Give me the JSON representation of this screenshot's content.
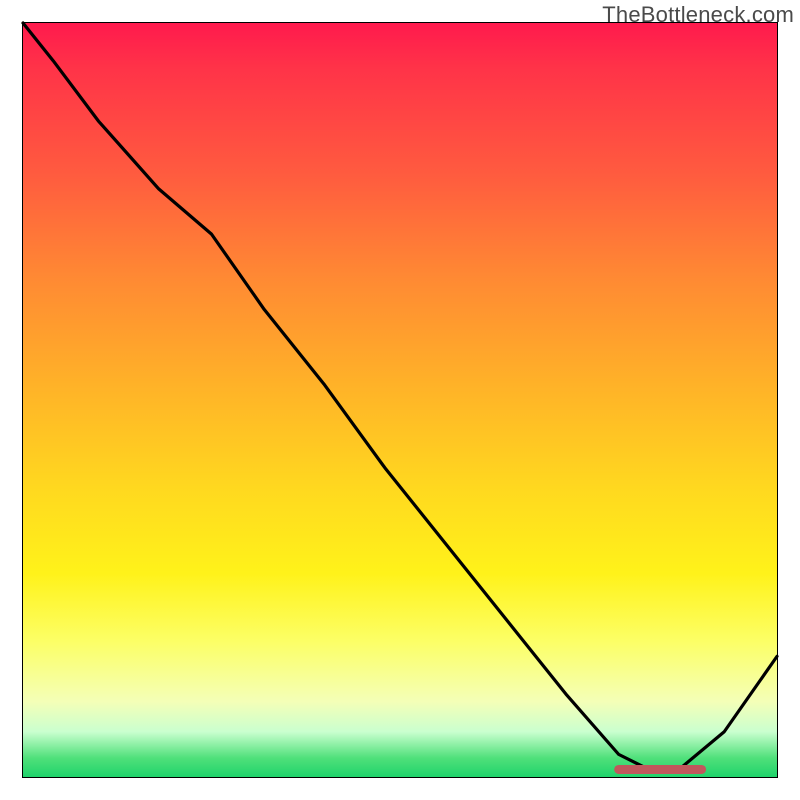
{
  "watermark": "TheBottleneck.com",
  "chart_data": {
    "type": "line",
    "title": "",
    "xlabel": "",
    "ylabel": "",
    "xlim": [
      0,
      100
    ],
    "ylim": [
      0,
      100
    ],
    "grid": false,
    "series": [
      {
        "name": "bottleneck-curve",
        "x": [
          0,
          4,
          10,
          18,
          25,
          32,
          40,
          48,
          56,
          64,
          72,
          79,
          83,
          87,
          93,
          100
        ],
        "values": [
          100,
          95,
          87,
          78,
          72,
          62,
          52,
          41,
          31,
          21,
          11,
          3,
          1,
          1,
          6,
          16
        ]
      }
    ],
    "annotations": [
      {
        "name": "optimal-range-bar",
        "x_start": 79,
        "x_end": 90,
        "y": 1
      }
    ],
    "background_gradient": {
      "top": "#ff1a4d",
      "mid_upper": "#ff8a33",
      "mid": "#ffd91f",
      "mid_lower": "#fcff66",
      "bottom": "#1fd36b"
    }
  }
}
